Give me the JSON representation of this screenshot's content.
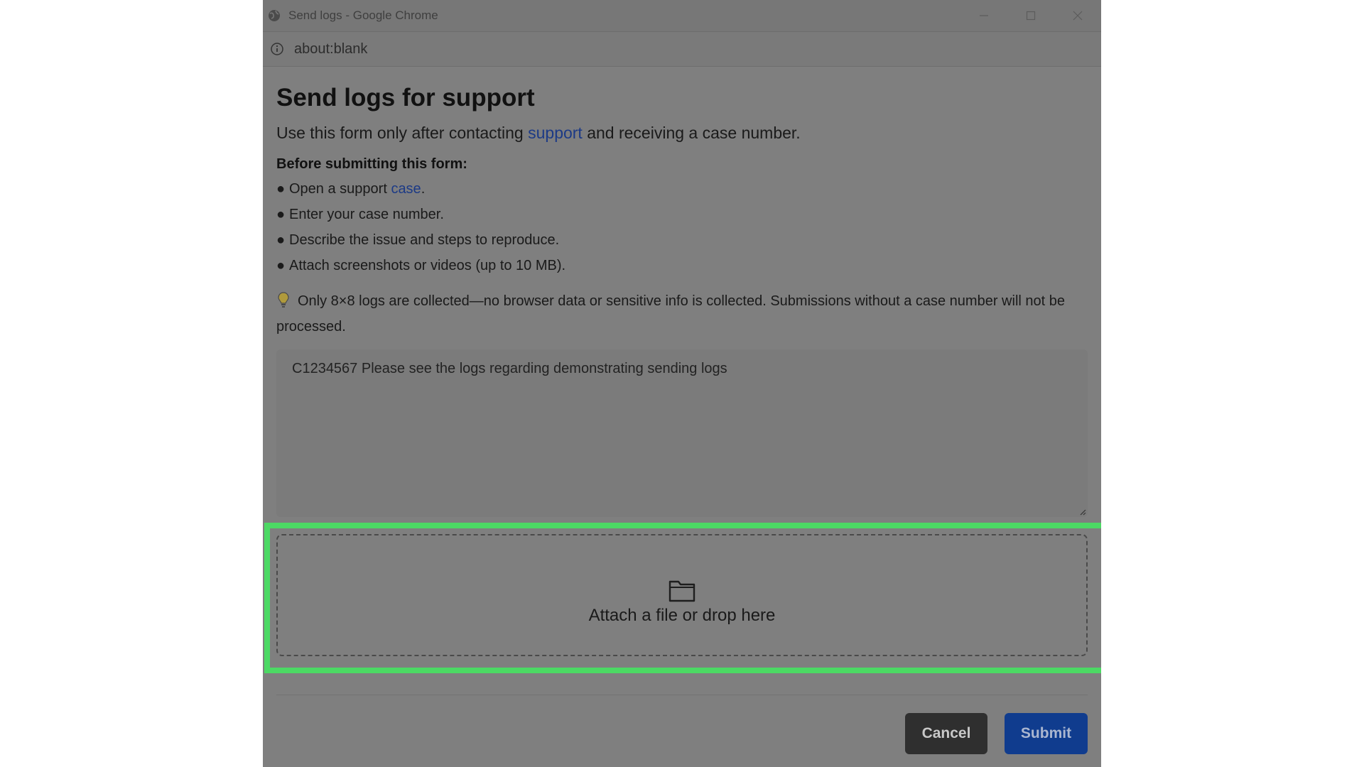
{
  "window": {
    "title": "Send logs - Google Chrome",
    "url": "about:blank"
  },
  "page": {
    "title": "Send logs for support",
    "intro_before": "Use this form only after contacting",
    "intro_link": "support",
    "intro_after": "and receiving a case number.",
    "before_heading": "Before submitting this form:",
    "steps": {
      "s1_before": "Open a support",
      "s1_link": "case",
      "s1_after": ".",
      "s2": "Enter your case number.",
      "s3": "Describe the issue and steps to reproduce.",
      "s4": "Attach screenshots or videos (up to 10 MB)."
    },
    "bullet": "●",
    "notice": "Only 8×8 logs are collected—no browser data or sensitive info is collected. Submissions without a case number will not be processed."
  },
  "form": {
    "description_value": "C1234567 Please see the logs regarding demonstrating sending logs",
    "dropzone_label": "Attach a file or drop here",
    "cancel_label": "Cancel",
    "submit_label": "Submit"
  },
  "colors": {
    "highlight": "#4cd964",
    "link": "#1c3a86",
    "submit_bg": "#103c8e",
    "cancel_bg": "#2f2f2f",
    "overlay": "#7f7f7f"
  },
  "icons": {
    "app": "chrome-globe-icon",
    "info": "info-icon",
    "notice": "lightbulb-icon",
    "upload": "folder-icon"
  }
}
